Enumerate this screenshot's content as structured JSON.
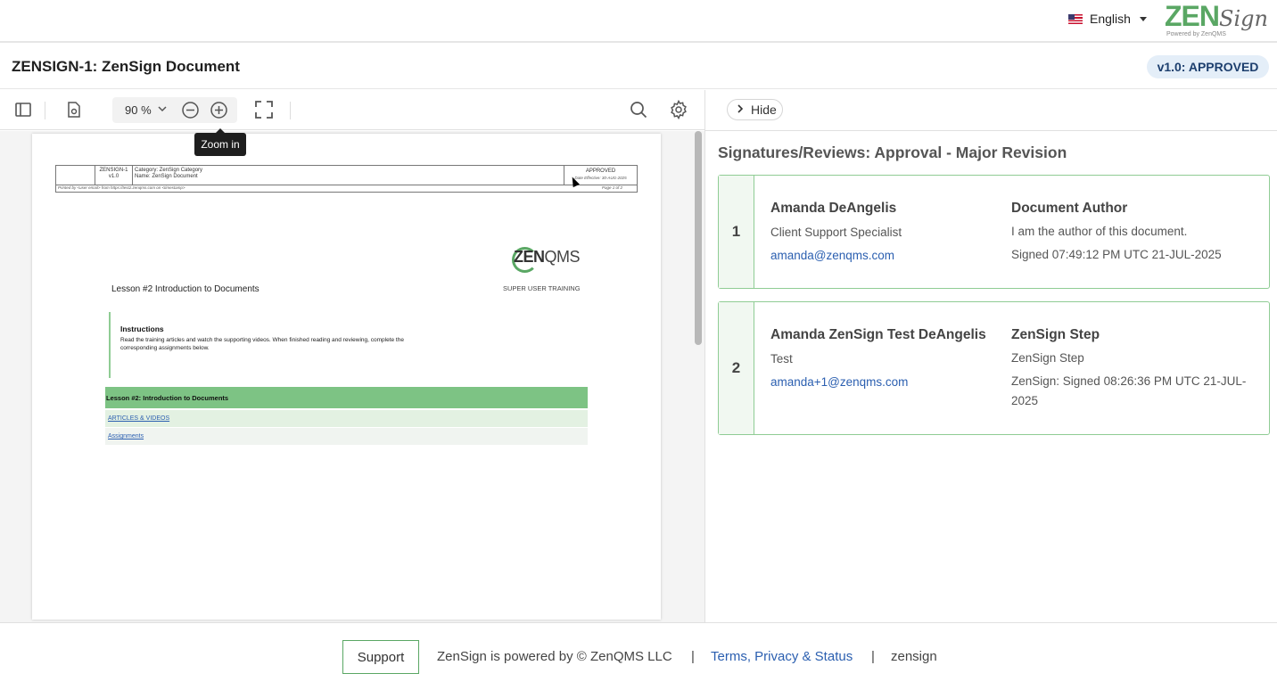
{
  "topbar": {
    "language": "English",
    "logo_main": "ZEN",
    "logo_sign": "Sign",
    "logo_sub": "Powered by ZenQMS"
  },
  "titlebar": {
    "doc_title": "ZENSIGN-1: ZenSign Document",
    "version_badge": "v1.0: APPROVED"
  },
  "toolbar": {
    "zoom_value": "90 %",
    "tooltip": "Zoom in",
    "icons": [
      "sidebar-toggle-icon",
      "document-settings-icon",
      "chevron-down-icon",
      "zoom-out-icon",
      "zoom-in-icon",
      "fullscreen-icon",
      "search-icon",
      "gear-icon"
    ]
  },
  "document": {
    "header": {
      "doc_id": "ZENSIGN-1",
      "version": "v1.0",
      "category": "Category: ZenSign Category",
      "name": "Name: ZenSign Document",
      "status": "APPROVED",
      "effective": "Date Effective: 30-AUG-2025",
      "printed_by": "Printed by <user email> from https://test2.zenqms.com on <timestamp>",
      "page": "Page 1 of 2"
    },
    "logo_text_bold": "ZEN",
    "logo_text": "QMS",
    "logo_sub": "SUPER USER TRAINING",
    "lesson_title": "Lesson #2 Introduction to Documents",
    "instructions_heading": "Instructions",
    "instructions_text": "Read the training articles and watch the supporting videos. When finished reading and reviewing, complete the corresponding assignments below.",
    "lesson_bar": "Lesson #2: Introduction to Documents",
    "articles_link": "ARTICLES & VIDEOS",
    "assignments_link": "Assignments"
  },
  "panel": {
    "hide_label": "Hide",
    "heading": "Signatures/Reviews: Approval - Major Revision",
    "signatures": [
      {
        "number": "1",
        "name": "Amanda DeAngelis",
        "title": "Client Support Specialist",
        "email": "amanda@zenqms.com",
        "role": "Document Author",
        "statement": "I am the author of this document.",
        "signed": "Signed 07:49:12 PM UTC 21-JUL-2025"
      },
      {
        "number": "2",
        "name": "Amanda ZenSign Test DeAngelis",
        "title": "Test",
        "email": "amanda+1@zenqms.com",
        "role": "ZenSign Step",
        "statement": "ZenSign Step",
        "signed": "ZenSign: Signed 08:26:36 PM UTC 21-JUL-2025"
      }
    ]
  },
  "footer": {
    "support_label": "Support",
    "powered_by": "ZenSign is powered by © ZenQMS LLC",
    "sep": "|",
    "terms_link": "Terms, Privacy & Status",
    "env": "zensign"
  },
  "colors": {
    "brand_green": "#5aa764",
    "link_blue": "#2b5fb0",
    "badge_bg": "#e4eef8",
    "badge_text": "#1d3f6e"
  }
}
